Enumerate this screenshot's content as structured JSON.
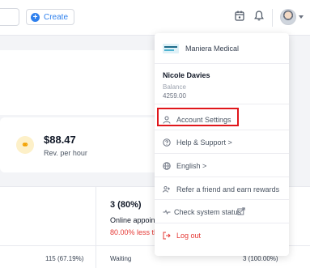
{
  "header": {
    "create_label": "Create",
    "plus_glyph": "+",
    "accent_color": "#2f80ed"
  },
  "revenue_card": {
    "value": "$88.47",
    "label": "Rev. per hour",
    "icon": "coins-icon"
  },
  "stats": {
    "big_value": "3 (80%)",
    "subtitle": "Online appoint",
    "comparison": "80.00% less th",
    "left_value": "115 (67.19%)",
    "waiting_label": "Waiting",
    "waiting_value": "3 (100.00%)"
  },
  "dropdown": {
    "brand_name": "Maniera Medical",
    "user_name": "Nicole Davies",
    "balance_label": "Balance",
    "balance_value": "4259.00",
    "items": [
      {
        "label": "Account Settings",
        "icon": "user-icon"
      },
      {
        "label": "Help & Support >",
        "icon": "help-icon"
      },
      {
        "label": "English >",
        "icon": "globe-icon"
      },
      {
        "label": "Refer a friend and earn rewards",
        "icon": "refer-icon"
      },
      {
        "label": "Check system status",
        "icon": "pulse-icon"
      },
      {
        "label": "Log out",
        "icon": "logout-icon"
      }
    ],
    "highlight_color": "#e0161b",
    "logout_color": "#e53935"
  }
}
